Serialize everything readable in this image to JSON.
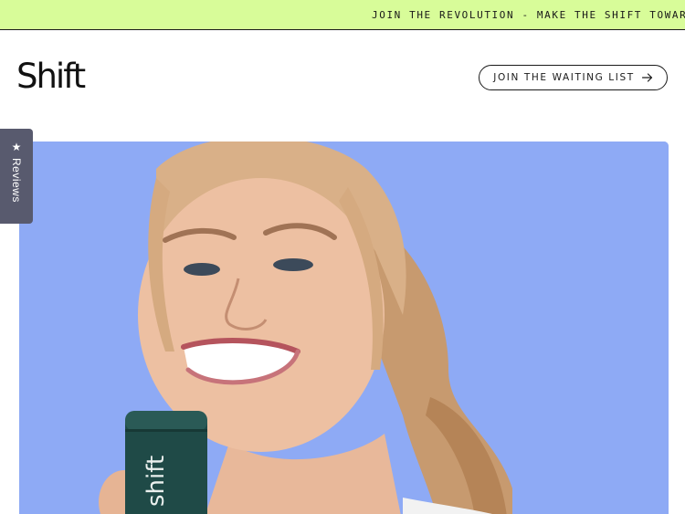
{
  "announcement": {
    "text": "JOIN THE REVOLUTION - MAKE THE SHIFT TOWARD"
  },
  "header": {
    "logo": "Shift",
    "cta_label": "JOIN THE WAITING LIST"
  },
  "reviews_tab": {
    "label": "Reviews",
    "icon": "star-icon"
  },
  "hero": {
    "bottle_text": "shift",
    "background_color": "#8eaaf5"
  },
  "colors": {
    "announcement_bg": "#d8fc99",
    "bottle": "#1f4a47",
    "reviews_tab": "#585a6e"
  }
}
